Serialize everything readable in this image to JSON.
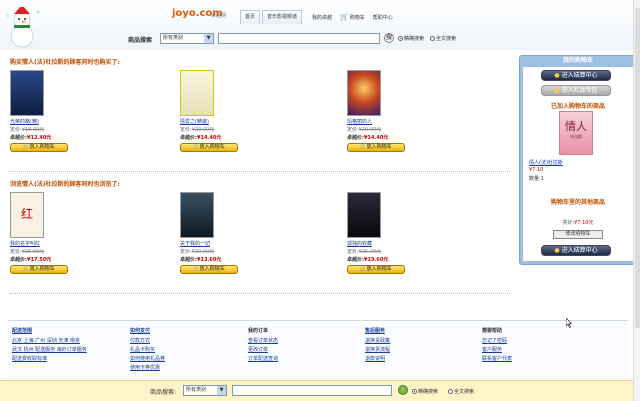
{
  "header": {
    "logo": "joyo.com",
    "logo_sub": "卓越网",
    "nav": [
      "首页",
      "音乐影视频道",
      "我的卓越",
      "购物车",
      "帮助中心"
    ],
    "search": {
      "label": "商品搜索",
      "category": "所有类别",
      "query": "",
      "go": "搜",
      "option_1": "精确搜索",
      "option_2": "全文搜索"
    }
  },
  "section1": {
    "title": "购买情人(法)杜拉斯的顾客同时也购买了:",
    "products": [
      {
        "title": "光荣的路(精)",
        "list_price_label": "定价:",
        "list_price": "¥18.00元",
        "sale_label": "卓越价:",
        "sale_price": "¥12.40元",
        "buy": "放入购物车",
        "cover_color": "#1e3a7a"
      },
      {
        "title": "情爱之(精装)",
        "list_price_label": "定价:",
        "list_price": "¥20.00元",
        "sale_label": "卓越价:",
        "sale_price": "¥14.40元",
        "buy": "放入购物车",
        "cover_color": "#f4f0d0"
      },
      {
        "title": "玛格丽的人",
        "list_price_label": "定价:",
        "list_price": "¥20.00元",
        "sale_label": "卓越价:",
        "sale_price": "¥14.40元",
        "buy": "放入购物车",
        "cover_color": "#c84a20"
      }
    ]
  },
  "section2": {
    "title": "浏览情人(法)杜拉斯的顾客同时也浏览了:",
    "products": [
      {
        "title": "我的名字叫红",
        "list_price_label": "定价:",
        "list_price": "¥25.00元",
        "sale_label": "卓越价:",
        "sale_price": "¥17.50元",
        "buy": "放入购物车",
        "cover_color": "#f7f2e2",
        "cover_text": "红"
      },
      {
        "title": "关于我的一切",
        "list_price_label": "定价:",
        "list_price": "¥20.00元",
        "sale_label": "卓越价:",
        "sale_price": "¥13.60元",
        "buy": "放入购物车",
        "cover_color": "#223344"
      },
      {
        "title": "孤独的收藏",
        "list_price_label": "定价:",
        "list_price": "¥25.00元",
        "sale_label": "卓越价:",
        "sale_price": "¥19.60元",
        "buy": "放入购物车",
        "cover_color": "#15151f"
      }
    ]
  },
  "sidebar": {
    "title": "我的购物车",
    "checkout": "进入结算中心",
    "gift": "进入礼品专区",
    "added_title": "已加入购物车的商品",
    "added_cover_text": "情人",
    "added_cover_sub": "杜拉斯",
    "added_link": "情人(法)杜拉斯",
    "added_price": "¥7.10",
    "qty": "数量:1",
    "other_title": "购物车里的其他商品",
    "total_label": "共计:",
    "total_value": "¥7.10元",
    "modify": "修改购物车",
    "checkout2": "进入结算中心"
  },
  "footer": {
    "cols": [
      {
        "head": "配送范围",
        "items": [
          "北京 上海 广州 深圳 天津 南京",
          "武汉 杭州 配送服务 海外订单服务",
          "配送费收取标准"
        ]
      },
      {
        "head": "如何支付",
        "items": [
          "付款方式",
          "礼品卡购买",
          "如何使用礼品券",
          "使用卡券优惠"
        ]
      },
      {
        "head": "我的订单",
        "items": [
          "查看订单状态",
          "更改订单",
          "订单配送查询"
        ]
      },
      {
        "head": "售后服务",
        "items": [
          "退换货政策",
          "退换货流程",
          "退款说明"
        ]
      },
      {
        "head": "需要帮助",
        "items": [
          "忘记了密码",
          "客户服务",
          "联系客户代表"
        ]
      }
    ],
    "search_label": "商品搜索:",
    "category": "所有类别",
    "option_1": "精确搜索",
    "option_2": "全文搜索"
  }
}
